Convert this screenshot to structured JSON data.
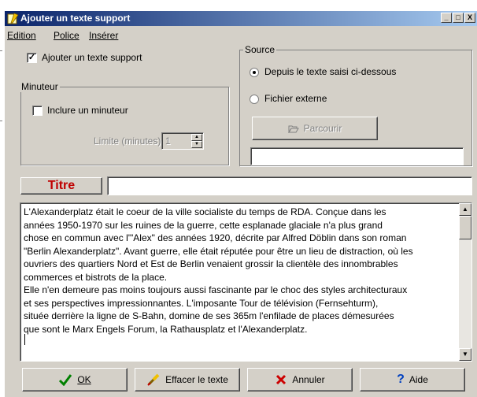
{
  "window": {
    "title": "Ajouter un texte support",
    "minimize": "_",
    "maximize": "□",
    "close": "X"
  },
  "menu": [
    "Edition",
    "Police",
    "Insérer"
  ],
  "options": {
    "add_support_text": {
      "label": "Ajouter un texte support",
      "checked": true
    }
  },
  "timer": {
    "group_label": "Minuteur",
    "include_label": "Inclure un minuteur",
    "include_checked": false,
    "limit_label": "Limite (minutes):",
    "limit_value": "1"
  },
  "source": {
    "group_label": "Source",
    "option_text": "Depuis le texte saisi ci-dessous",
    "option_file": "Fichier externe",
    "selected": "text",
    "browse_label": "Parcourir",
    "file_path": ""
  },
  "title_field": {
    "label": "Titre",
    "value": ""
  },
  "body_text": "L'Alexanderplatz était le coeur de la ville socialiste du temps de RDA. Conçue dans les\nannées 1950-1970 sur les ruines de la guerre, cette esplanade glaciale n'a plus grand\nchose en commun avec l'\"Alex\" des années 1920, décrite par Alfred Döblin dans son roman\n\"Berlin Alexanderplatz\". Avant guerre, elle était réputée pour être un lieu de distraction, où les\nouvriers des quartiers Nord et Est de Berlin venaient grossir la clientèle des innombrables\ncommerces et bistrots de la place.\nElle n'en demeure pas moins toujours aussi fascinante par le choc des styles architecturaux\net ses perspectives impressionnantes. L'imposante Tour de télévision (Fernsehturm),\nsituée derrière la ligne de S-Bahn, domine de ses 365m l'enfilade de places démesurées\nque sont le Marx Engels Forum, la Rathausplatz et l'Alexanderplatz.",
  "buttons": {
    "ok": "OK",
    "clear": "Effacer le texte",
    "cancel": "Annuler",
    "help": "Aide"
  },
  "colors": {
    "title_label": "#c00000",
    "ok_check": "#008000",
    "cancel_x": "#cc0000",
    "help_q": "#0040c0"
  }
}
